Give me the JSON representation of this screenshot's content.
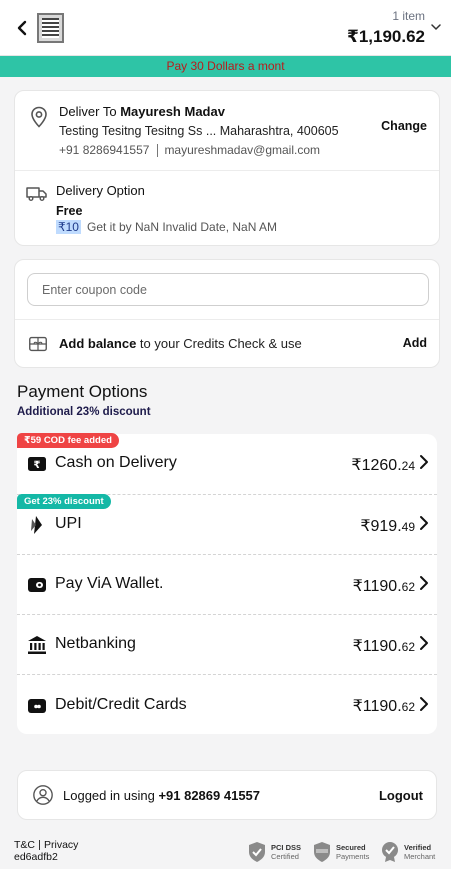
{
  "header": {
    "items_count": "1 item",
    "total": "₹1,190.62"
  },
  "banner": {
    "text": "Pay 30 Dollars a mont"
  },
  "address": {
    "deliver_prefix": "Deliver To",
    "name": "Mayuresh Madav",
    "line": "Testing Tesitng Tesitng Ss ... Maharashtra, 400605",
    "phone": "+91 8286941557",
    "email": "mayureshmadav@gmail.com",
    "change_label": "Change"
  },
  "delivery": {
    "title": "Delivery Option",
    "type": "Free",
    "price_tag": "₹10",
    "eta": "Get it by NaN Invalid Date, NaN AM"
  },
  "coupon": {
    "placeholder": "Enter coupon code",
    "balance_bold": "Add balance",
    "balance_rest": "to your Credits Check & use",
    "add_label": "Add"
  },
  "payment": {
    "title": "Payment Options",
    "subtitle": "Additional 23% discount",
    "methods": [
      {
        "icon": "cash-icon",
        "label": "Cash on Delivery",
        "price_main": "₹1260.",
        "price_dec": "24",
        "badge": "₹59 COD fee added",
        "badge_color": "#ef4444"
      },
      {
        "icon": "upi-icon",
        "label": "UPI",
        "price_main": "₹919.",
        "price_dec": "49",
        "badge": "Get 23% discount",
        "badge_color": "#14b8a6"
      },
      {
        "icon": "wallet-icon",
        "label": "Pay ViA Wallet.",
        "price_main": "₹1190.",
        "price_dec": "62"
      },
      {
        "icon": "bank-icon",
        "label": "Netbanking",
        "price_main": "₹1190.",
        "price_dec": "62"
      },
      {
        "icon": "card-icon",
        "label": "Debit/Credit Cards",
        "price_main": "₹1190.",
        "price_dec": "62"
      }
    ]
  },
  "login": {
    "prefix": "Logged in using",
    "phone": "+91 82869 41557",
    "logout_label": "Logout"
  },
  "footer": {
    "tc": "T&C",
    "privacy": "Privacy",
    "build": "ed6adfb2",
    "trust": [
      {
        "icon": "pci-shield-icon",
        "line1": "PCI DSS",
        "line2": "Certified"
      },
      {
        "icon": "secure-badge-icon",
        "line1": "Secured",
        "line2": "Payments"
      },
      {
        "icon": "verified-merchant-icon",
        "line1": "Verified",
        "line2": "Merchant"
      }
    ]
  },
  "colors": {
    "banner_bg": "#2ec4a6",
    "banner_text": "#b91c1c",
    "cod_badge": "#ef4444",
    "upi_badge": "#14b8a6"
  }
}
